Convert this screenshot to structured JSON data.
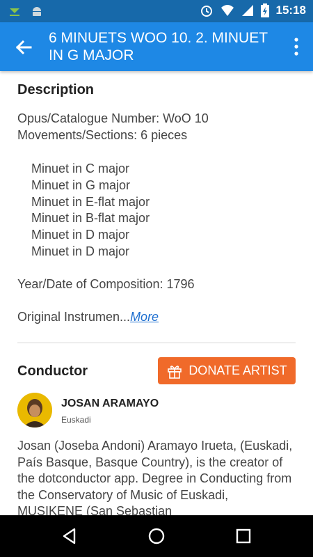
{
  "status_bar": {
    "time": "15:18",
    "icons": [
      "download-icon",
      "android-icon",
      "alarm-icon",
      "wifi-icon",
      "signal-icon",
      "battery-icon"
    ]
  },
  "app_bar": {
    "title": "6 MINUETS WOO 10. 2. MINUET IN G MAJOR",
    "back_icon": "arrow-back-icon",
    "menu_icon": "more-vert-icon"
  },
  "description": {
    "heading": "Description",
    "opus": "Opus/Catalogue Number: WoO 10",
    "movements": "Movements/Sections: 6 pieces",
    "pieces": [
      "Minuet in C major",
      "Minuet in G major",
      "Minuet in E-flat major",
      "Minuet in B-flat major",
      "Minuet in D major",
      "Minuet in D major"
    ],
    "year": "Year/Date of Composition:  1796",
    "instrumentation_truncated": "Original Instrumen...",
    "more_link": "More"
  },
  "conductor": {
    "heading": "Conductor",
    "donate_label": "DONATE ARTIST",
    "name": "JOSAN ARAMAYO",
    "location": "Euskadi",
    "bio": "Josan (Joseba Andoni) Aramayo Irueta, (Euskadi, País Basque, Basque Country), is the creator of the  dotconductor app. Degree in Conducting from the Conservatory of Music of Euskadi, MUSIKENE (San Sebastian"
  },
  "colors": {
    "status_bar": "#1769aa",
    "app_bar": "#1e88e5",
    "donate": "#f06a2a",
    "link": "#1e6fd0"
  }
}
